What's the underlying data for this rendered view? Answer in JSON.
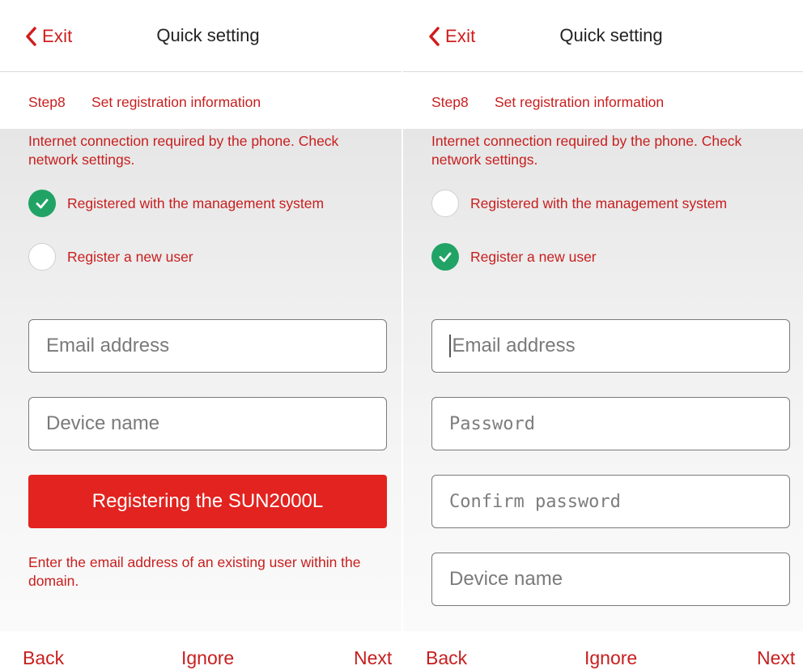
{
  "colors": {
    "accent": "#d01c1c",
    "text_red": "#c81e1e",
    "button_red": "#e2231f",
    "check_green": "#21a366",
    "field_border": "#7a7a7a",
    "placeholder": "#7a7a7a"
  },
  "icons": {
    "back": "chevron-left-icon",
    "checked": "check-circle-icon",
    "unchecked": "empty-circle-icon"
  },
  "left": {
    "header": {
      "exit_label": "Exit",
      "title": "Quick setting"
    },
    "step": {
      "number": "Step8",
      "description": "Set registration information"
    },
    "notice": "Internet connection required by the phone. Check network settings.",
    "options": [
      {
        "label": "Registered with the management system",
        "selected": true
      },
      {
        "label": "Register a new user",
        "selected": false
      }
    ],
    "fields": [
      {
        "placeholder": "Email address",
        "value": ""
      },
      {
        "placeholder": "Device name",
        "value": ""
      }
    ],
    "primary_button": "Registering the SUN2000L",
    "hint": "Enter the email address of an existing user within the domain.",
    "nav": {
      "back": "Back",
      "ignore": "Ignore",
      "next": "Next"
    }
  },
  "right": {
    "header": {
      "exit_label": "Exit",
      "title": "Quick setting"
    },
    "step": {
      "number": "Step8",
      "description": "Set registration information"
    },
    "notice": "Internet connection required by the phone. Check network settings.",
    "options": [
      {
        "label": "Registered with the management system",
        "selected": false
      },
      {
        "label": "Register a new user",
        "selected": true
      }
    ],
    "fields": [
      {
        "placeholder": "Email address",
        "value": "",
        "focused": true
      },
      {
        "placeholder": "Password",
        "value": ""
      },
      {
        "placeholder": "Confirm password",
        "value": ""
      },
      {
        "placeholder": "Device name",
        "value": ""
      }
    ],
    "nav": {
      "back": "Back",
      "ignore": "Ignore",
      "next": "Next"
    }
  }
}
